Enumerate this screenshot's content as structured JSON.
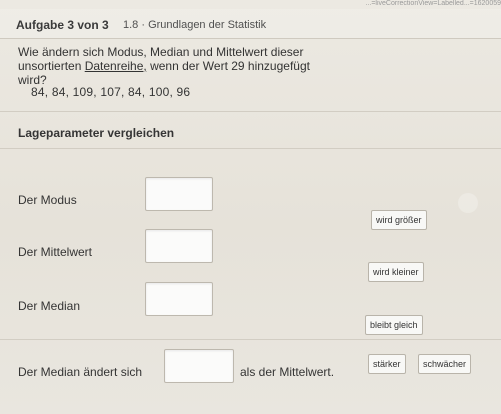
{
  "browser": {
    "url_fragment": "...=liveCorrectionView=Labelled...=1620059"
  },
  "header": {
    "task_number": "Aufgabe 3 von 3",
    "task_topic": "1.8 · Grundlagen der Statistik"
  },
  "question": {
    "text_before_link": "Wie ändern sich Modus, Median und Mittelwert dieser unsortierten ",
    "link_text": "Datenreihe,",
    "text_after_link": " wenn der Wert 29 hinzugefügt wird?"
  },
  "dataseries": "84, 84, 109, 107, 84, 100, 96",
  "section": {
    "heading": "Lageparameter vergleichen"
  },
  "rows": [
    {
      "label": "Der Modus"
    },
    {
      "label": "Der Mittelwert"
    },
    {
      "label": "Der Median"
    }
  ],
  "choices": {
    "wird_groesser": "wird größer",
    "wird_kleiner": "wird kleiner",
    "bleibt_gleich": "bleibt gleich",
    "staerker": "stärker",
    "schwaecher": "schwächer"
  },
  "final_sentence": {
    "before": "Der Median ändert sich",
    "after": "als der Mittelwert."
  }
}
